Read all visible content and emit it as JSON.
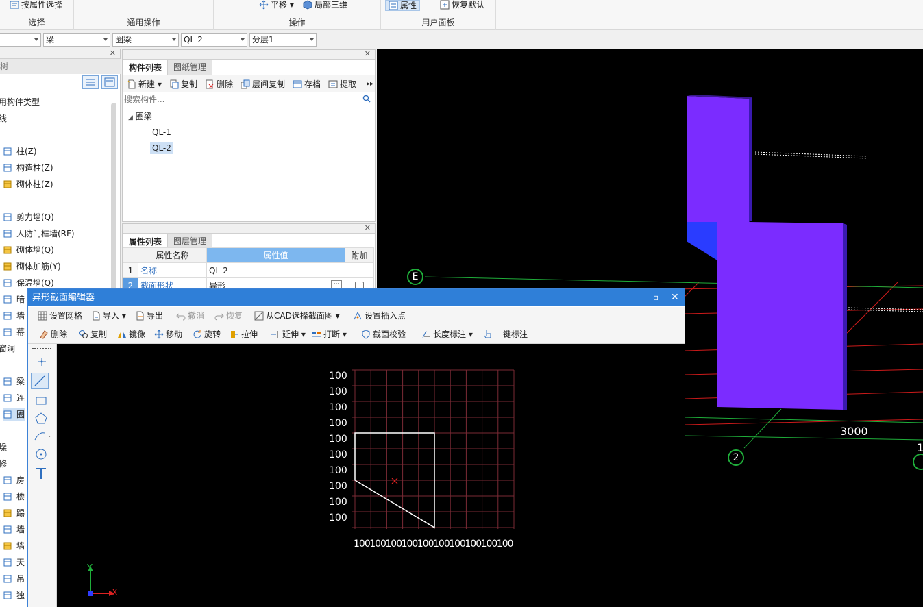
{
  "ribbon": {
    "groups": [
      {
        "name": "选择",
        "buttons": [
          "按属性选择"
        ]
      },
      {
        "name": "通用操作",
        "buttons": []
      },
      {
        "name": "操作",
        "buttons": [
          "平移",
          "局部三维"
        ]
      },
      {
        "name": "用户面板",
        "buttons": [
          "属性",
          "恢复默认"
        ]
      }
    ]
  },
  "combos": {
    "floor": "",
    "type": "梁",
    "subtype": "圈梁",
    "component": "QL-2",
    "layer": "分层1"
  },
  "lefttree": {
    "header": "树",
    "items": [
      {
        "label": "用构件类型",
        "icon": "none"
      },
      {
        "label": "线",
        "icon": "none"
      },
      {
        "label": "柱(Z)",
        "icon": "column-icon"
      },
      {
        "label": "构造柱(Z)",
        "icon": "structural-column-icon"
      },
      {
        "label": "砌体柱(Z)",
        "icon": "masonry-column-icon"
      },
      {
        "label": "剪力墙(Q)",
        "icon": "shear-wall-icon"
      },
      {
        "label": "人防门框墙(RF)",
        "icon": "door-frame-wall-icon"
      },
      {
        "label": "砌体墙(Q)",
        "icon": "masonry-wall-icon"
      },
      {
        "label": "砌体加筋(Y)",
        "icon": "masonry-rebar-icon"
      },
      {
        "label": "保温墙(Q)",
        "icon": "insulation-wall-icon"
      },
      {
        "label": "暗",
        "icon": "hidden-icon"
      },
      {
        "label": "墙",
        "icon": "wall-icon"
      },
      {
        "label": "幕",
        "icon": "curtain-icon"
      },
      {
        "label": "窗洞",
        "icon": "none"
      },
      {
        "label": "梁",
        "icon": "beam-icon"
      },
      {
        "label": "连",
        "icon": "link-beam-icon"
      },
      {
        "label": "圈",
        "icon": "ring-beam-icon"
      },
      {
        "label": "燥",
        "icon": "none"
      },
      {
        "label": "修",
        "icon": "none"
      },
      {
        "label": "房",
        "icon": "room-icon"
      },
      {
        "label": "楼",
        "icon": "floor-icon"
      },
      {
        "label": "踢",
        "icon": "skirting-icon"
      },
      {
        "label": "墙",
        "icon": "wall-face-icon"
      },
      {
        "label": "墙",
        "icon": "wall-skirt-icon"
      },
      {
        "label": "天",
        "icon": "ceiling-icon"
      },
      {
        "label": "吊",
        "icon": "suspended-ceiling-icon"
      },
      {
        "label": "独",
        "icon": "independent-icon"
      }
    ]
  },
  "complist": {
    "tabs": [
      "构件列表",
      "图纸管理"
    ],
    "toolbar": [
      "新建",
      "复制",
      "删除",
      "层间复制",
      "存档",
      "提取"
    ],
    "search_placeholder": "搜索构件...",
    "root": "圈梁",
    "children": [
      "QL-1",
      "QL-2"
    ],
    "selected": "QL-2"
  },
  "proppanel": {
    "tabs": [
      "属性列表",
      "图层管理"
    ],
    "headers": [
      "属性名称",
      "属性值",
      "附加"
    ],
    "rows": [
      {
        "num": "1",
        "name": "名称",
        "value": "QL-2"
      },
      {
        "num": "2",
        "name": "截面形状",
        "value": "异形"
      }
    ]
  },
  "viewport": {
    "axis_labels": [
      "E",
      "2"
    ],
    "dimension": "3000",
    "edge_label": "1"
  },
  "editor": {
    "title": "异形截面编辑器",
    "toolbar1": [
      "设置网格",
      "导入",
      "导出",
      "撤消",
      "恢复",
      "从CAD选择截面图",
      "设置插入点"
    ],
    "toolbar2": [
      "删除",
      "复制",
      "镜像",
      "移动",
      "旋转",
      "拉伸",
      "延伸",
      "打断",
      "截面校验",
      "长度标注",
      "一键标注"
    ],
    "grid": {
      "row_labels": [
        "100",
        "100",
        "100",
        "100",
        "100",
        "100",
        "100",
        "100",
        "100",
        "100"
      ],
      "col_labels": [
        "100",
        "100",
        "100",
        "100",
        "100",
        "100",
        "100",
        "100",
        "100",
        "100"
      ]
    },
    "axes": {
      "x": "X",
      "y": "Y"
    },
    "colors": {
      "accent": "#2f7fd8",
      "shape": "#7b2cff",
      "grid": "#7a2a35"
    }
  }
}
